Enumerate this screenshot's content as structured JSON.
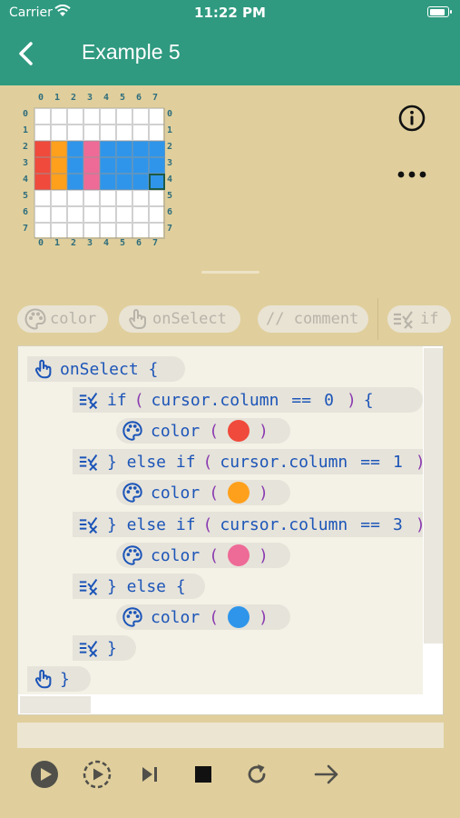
{
  "status_bar": {
    "carrier": "Carrier",
    "time": "11:22 PM",
    "battery_level": 0.85
  },
  "nav": {
    "title": "Example 5",
    "back_icon": "chevron-left-icon"
  },
  "grid": {
    "columns": [
      "0",
      "1",
      "2",
      "3",
      "4",
      "5",
      "6",
      "7"
    ],
    "rows": [
      "0",
      "1",
      "2",
      "3",
      "4",
      "5",
      "6",
      "7"
    ],
    "colored_rows": [
      "2",
      "3",
      "4"
    ],
    "row_colors": [
      "#ef4a3c",
      "#ffa01c",
      "#2f95ea",
      "#ee6a97",
      "#2f95ea",
      "#2f95ea",
      "#2f95ea",
      "#2f95ea"
    ],
    "selected_cell": {
      "row": "4",
      "column": "7"
    },
    "selected_border": "#1e5a46"
  },
  "palette": [
    {
      "label": "color",
      "icon": "palette-icon"
    },
    {
      "label": "onSelect",
      "icon": "tap-hand-icon"
    },
    {
      "label": "// comment",
      "icon": ""
    },
    {
      "label": "if",
      "icon": "conditional-icon"
    }
  ],
  "code": {
    "on_select_open": "onSelect {",
    "if_kw": "if",
    "else_if_kw": "} else if",
    "else_kw": "} else {",
    "close": "}",
    "paren_open": "(",
    "paren_close": ")",
    "brace_open": "{",
    "operand": "cursor.column",
    "op": "==",
    "value_0": "0",
    "value_1": "1",
    "value_2": "3",
    "color_kw": "color",
    "colors": {
      "red": "#ef4a3c",
      "orange": "#ffa01c",
      "pink": "#ee6a97",
      "blue": "#2f95ea"
    }
  },
  "toolbar": [
    "play-icon",
    "step-icon",
    "skip-forward-icon",
    "stop-icon",
    "reset-icon",
    "forward-arrow-icon"
  ],
  "colors": {
    "nav": "#2f9a80",
    "background": "#e0cf9c",
    "code_text": "#1c55b8",
    "paren": "#8a3ab0"
  }
}
